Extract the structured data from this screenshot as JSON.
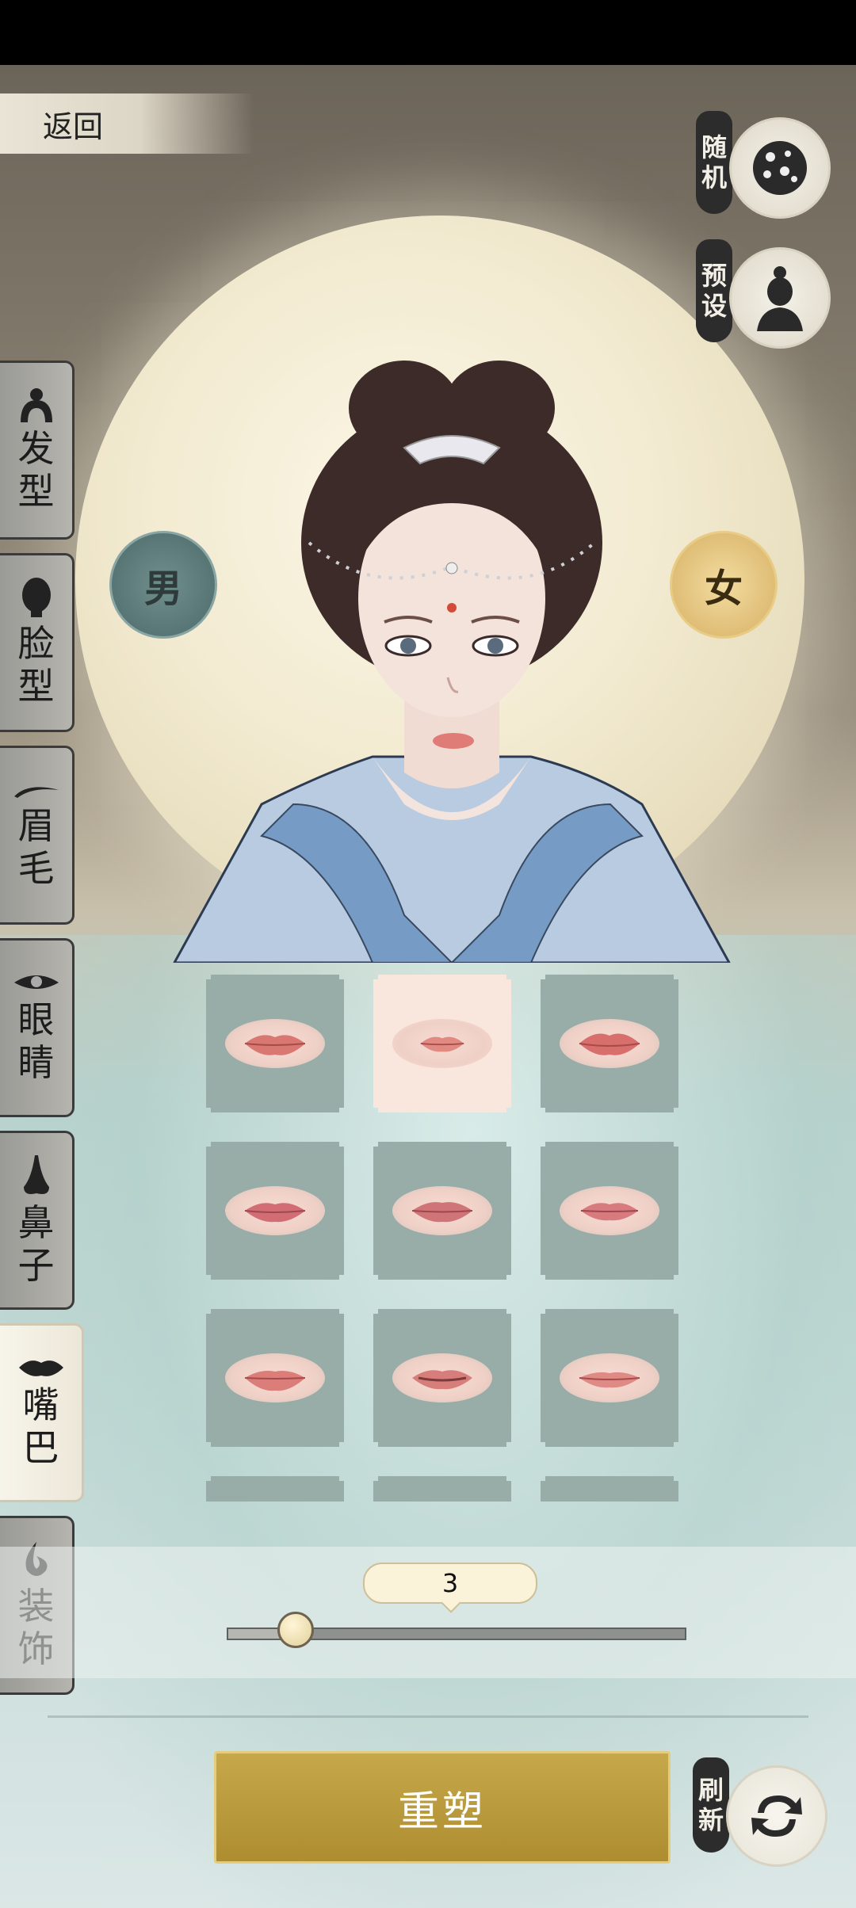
{
  "header": {
    "back_label": "返回"
  },
  "side_actions": {
    "random_label": "随机",
    "random_chars": [
      "随",
      "机"
    ],
    "preset_chars": [
      "预",
      "设"
    ],
    "refresh_chars": [
      "刷",
      "新"
    ]
  },
  "gender": {
    "male": "男",
    "female": "女",
    "selected": "female"
  },
  "tabs": [
    {
      "chars": [
        "发",
        "型"
      ],
      "icon": "hair-bun-icon"
    },
    {
      "chars": [
        "脸",
        "型"
      ],
      "icon": "face-icon"
    },
    {
      "chars": [
        "眉",
        "毛"
      ],
      "icon": "eyebrow-icon"
    },
    {
      "chars": [
        "眼",
        "睛"
      ],
      "icon": "eye-icon"
    },
    {
      "chars": [
        "鼻",
        "子"
      ],
      "icon": "nose-icon"
    },
    {
      "chars": [
        "嘴",
        "巴"
      ],
      "icon": "lips-icon",
      "active": true
    },
    {
      "chars": [
        "装",
        "饰"
      ],
      "icon": "ornament-icon"
    }
  ],
  "options": {
    "selected_index": 1,
    "count_visible": 9
  },
  "slider": {
    "value_text": "3",
    "value": 3,
    "min": 0,
    "max": 20
  },
  "rebuild_label": "重塑",
  "colors": {
    "accent_gold": "#b8993b",
    "tab_active": "#f3efe2",
    "cell": "#98aca8"
  }
}
